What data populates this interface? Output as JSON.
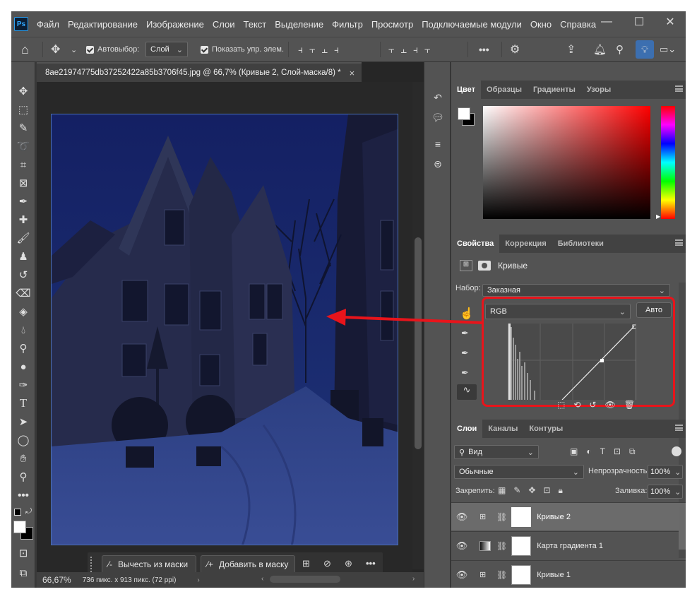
{
  "app": {
    "logo": "Ps"
  },
  "menu": [
    "Файл",
    "Редактирование",
    "Изображение",
    "Слои",
    "Текст",
    "Выделение",
    "Фильтр",
    "Просмотр",
    "Подключаемые модули",
    "Окно",
    "Справка"
  ],
  "window_controls": {
    "minimize": "—",
    "maximize": "☐",
    "close": "✕"
  },
  "options": {
    "autoselect_label": "Автовыбор:",
    "autoselect_value": "Слой",
    "show_controls_label": "Показать упр. элем.",
    "more": "•••"
  },
  "document": {
    "tab_title": "8ae21974775db37252422a85b3706f45.jpg @ 66,7% (Кривые 2, Слой-маска/8) *",
    "tab_close": "×"
  },
  "mask_toolbar": {
    "subtract_label": "Вычесть из маски",
    "add_label": "Добавить в маску",
    "more": "•••"
  },
  "status": {
    "zoom": "66,67%",
    "doc_info": "736 пикс. x 913 пикс. (72 ppi)"
  },
  "color_panel": {
    "tabs": [
      "Цвет",
      "Образцы",
      "Градиенты",
      "Узоры"
    ],
    "active_tab": 0
  },
  "properties_panel": {
    "tabs": [
      "Свойства",
      "Коррекция",
      "Библиотеки"
    ],
    "active_tab": 0,
    "type_label": "Кривые",
    "preset_label": "Набор:",
    "preset_value": "Заказная",
    "channel_value": "RGB",
    "auto_button": "Авто"
  },
  "layers_panel": {
    "tabs": [
      "Слои",
      "Каналы",
      "Контуры"
    ],
    "active_tab": 0,
    "filter_value": "Вид",
    "blend_mode": "Обычные",
    "opacity_label": "Непрозрачность:",
    "opacity_value": "100%",
    "lock_label": "Закрепить:",
    "fill_label": "Заливка:",
    "fill_value": "100%",
    "layers": [
      {
        "name": "Кривые 2",
        "selected": true
      },
      {
        "name": "Карта градиента 1",
        "selected": false
      },
      {
        "name": "Кривые 1",
        "selected": false
      }
    ]
  },
  "colors": {
    "accent": "#31a8ff",
    "annotation": "#e8141b",
    "canvas_tint": "#1c2a5c"
  }
}
